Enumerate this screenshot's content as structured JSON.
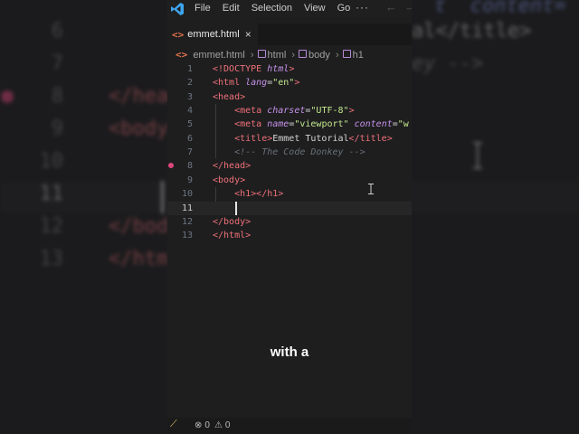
{
  "colors": {
    "tag": "#f07178",
    "attribute": "#c792ea",
    "string": "#c3e88d",
    "comment": "#697078",
    "file_icon": "#e3734b",
    "breakpoint": "#e0457b"
  },
  "background_blur": {
    "lines": [
      {
        "num": "6",
        "text": ""
      },
      {
        "num": "7",
        "text": ""
      },
      {
        "num": "8",
        "text": "</head>"
      },
      {
        "num": "9",
        "text": "<body>"
      },
      {
        "num": "10",
        "text": ""
      },
      {
        "num": "11",
        "text": ""
      },
      {
        "num": "12",
        "text": "</body>"
      },
      {
        "num": "13",
        "text": "</html>"
      }
    ],
    "right_fragments": {
      "top": "t  content=",
      "title_line": "al</title>",
      "comment_line": "ey -->"
    }
  },
  "titlebar": {
    "logo_icon": "vscode-logo-icon",
    "menu": [
      "File",
      "Edit",
      "Selection",
      "View",
      "Go"
    ],
    "more": "···",
    "back": "←",
    "forward": "→"
  },
  "tab": {
    "icon": "<>",
    "label": "emmet.html",
    "close": "×"
  },
  "breadcrumb": {
    "file_icon": "<>",
    "file": "emmet.html",
    "items": [
      "html",
      "body",
      "h1"
    ]
  },
  "editor": {
    "line_numbers": [
      "1",
      "2",
      "3",
      "4",
      "5",
      "6",
      "7",
      "8",
      "9",
      "10",
      "11",
      "12",
      "13"
    ],
    "current_line": "11",
    "lines": [
      [
        {
          "c": "t",
          "v": "<!DOCTYPE "
        },
        {
          "c": "a",
          "v": "html"
        },
        {
          "c": "t",
          "v": ">"
        }
      ],
      [
        {
          "c": "t",
          "v": "<html "
        },
        {
          "c": "a",
          "v": "lang"
        },
        {
          "c": "p",
          "v": "="
        },
        {
          "c": "s",
          "v": "\"en\""
        },
        {
          "c": "t",
          "v": ">"
        }
      ],
      [
        {
          "c": "t",
          "v": "<head>"
        }
      ],
      [
        {
          "c": "p",
          "v": "    "
        },
        {
          "c": "t",
          "v": "<meta "
        },
        {
          "c": "a",
          "v": "charset"
        },
        {
          "c": "p",
          "v": "="
        },
        {
          "c": "s",
          "v": "\"UTF-8\""
        },
        {
          "c": "t",
          "v": ">"
        }
      ],
      [
        {
          "c": "p",
          "v": "    "
        },
        {
          "c": "t",
          "v": "<meta "
        },
        {
          "c": "a",
          "v": "name"
        },
        {
          "c": "p",
          "v": "="
        },
        {
          "c": "s",
          "v": "\"viewport\""
        },
        {
          "c": "p",
          "v": " "
        },
        {
          "c": "a",
          "v": "content"
        },
        {
          "c": "p",
          "v": "="
        },
        {
          "c": "s",
          "v": "\"w"
        }
      ],
      [
        {
          "c": "p",
          "v": "    "
        },
        {
          "c": "t",
          "v": "<title>"
        },
        {
          "c": "p",
          "v": "Emmet Tutorial"
        },
        {
          "c": "t",
          "v": "</title>"
        }
      ],
      [
        {
          "c": "p",
          "v": "    "
        },
        {
          "c": "c",
          "v": "<!-- The Code Donkey -->"
        }
      ],
      [
        {
          "c": "t",
          "v": "</head>"
        }
      ],
      [
        {
          "c": "t",
          "v": "<body>"
        }
      ],
      [
        {
          "c": "p",
          "v": "    "
        },
        {
          "c": "t",
          "v": "<h1></h1>"
        }
      ],
      [
        {
          "c": "p",
          "v": "    "
        }
      ],
      [
        {
          "c": "t",
          "v": "</body>"
        }
      ],
      [
        {
          "c": "t",
          "v": "</html>"
        }
      ]
    ]
  },
  "caption": "with a",
  "statusbar": {
    "remote_icon": "remote-icon",
    "errors": "0",
    "warnings": "0"
  }
}
